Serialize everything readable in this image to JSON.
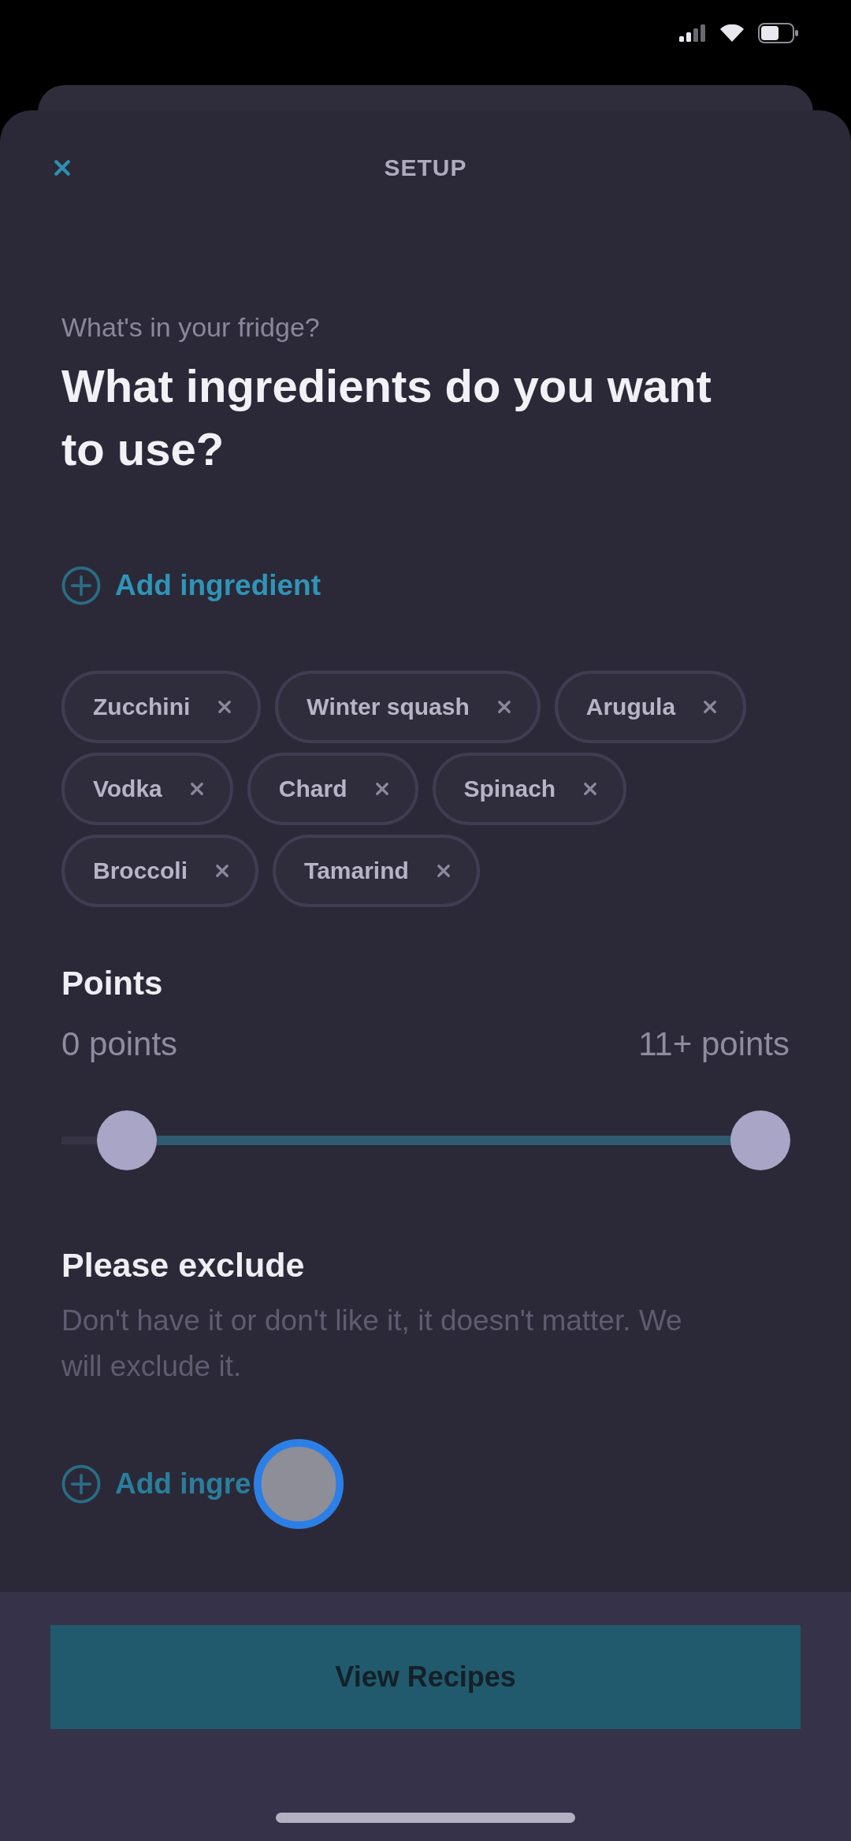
{
  "header": {
    "title": "SETUP"
  },
  "intro": {
    "subtitle": "What's in your fridge?",
    "title": "What ingredients do you want to use?"
  },
  "include": {
    "add_label": "Add ingredient",
    "chips": [
      "Zucchini",
      "Winter squash",
      "Arugula",
      "Vodka",
      "Chard",
      "Spinach",
      "Broccoli",
      "Tamarind"
    ]
  },
  "points": {
    "heading": "Points",
    "min_label": "0 points",
    "max_label": "11+ points",
    "range": [
      {
        "level": 0.09
      },
      {
        "level": 0.96
      }
    ]
  },
  "exclude": {
    "heading": "Please exclude",
    "description": "Don't have it or don't like it, it doesn't matter. We will exclude it.",
    "add_label": "Add ingre"
  },
  "footer": {
    "button": "View Recipes"
  }
}
